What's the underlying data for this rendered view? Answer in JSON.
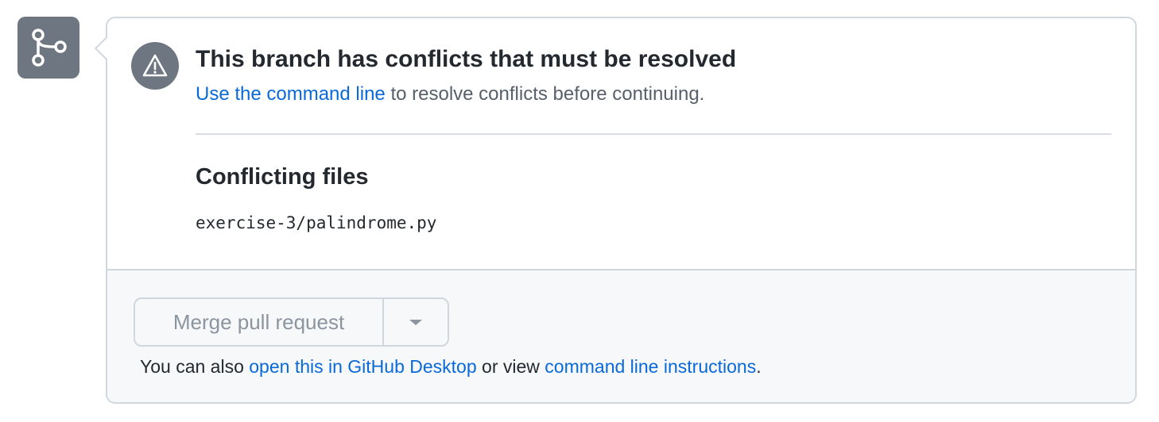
{
  "icons": {
    "branch": "git-branch-icon",
    "warning": "alert-icon",
    "dropdown": "triangle-down-icon"
  },
  "colors": {
    "icon_bg": "#6e7781",
    "link": "#0969da",
    "text": "#24292f",
    "muted": "#57606a",
    "disabled": "#8c959f",
    "footer_bg": "#f6f8fa",
    "border": "#d0d7de"
  },
  "status": {
    "title": "This branch has conflicts that must be resolved",
    "desc_link": "Use the command line",
    "desc_rest": " to resolve conflicts before continuing."
  },
  "conflicts": {
    "heading": "Conflicting files",
    "files": [
      "exercise-3/palindrome.py"
    ]
  },
  "merge": {
    "button_label": "Merge pull request",
    "alt_prefix": "You can also ",
    "desktop_link": "open this in GitHub Desktop",
    "alt_middle": " or view ",
    "instructions_link": "command line instructions",
    "alt_suffix": "."
  }
}
